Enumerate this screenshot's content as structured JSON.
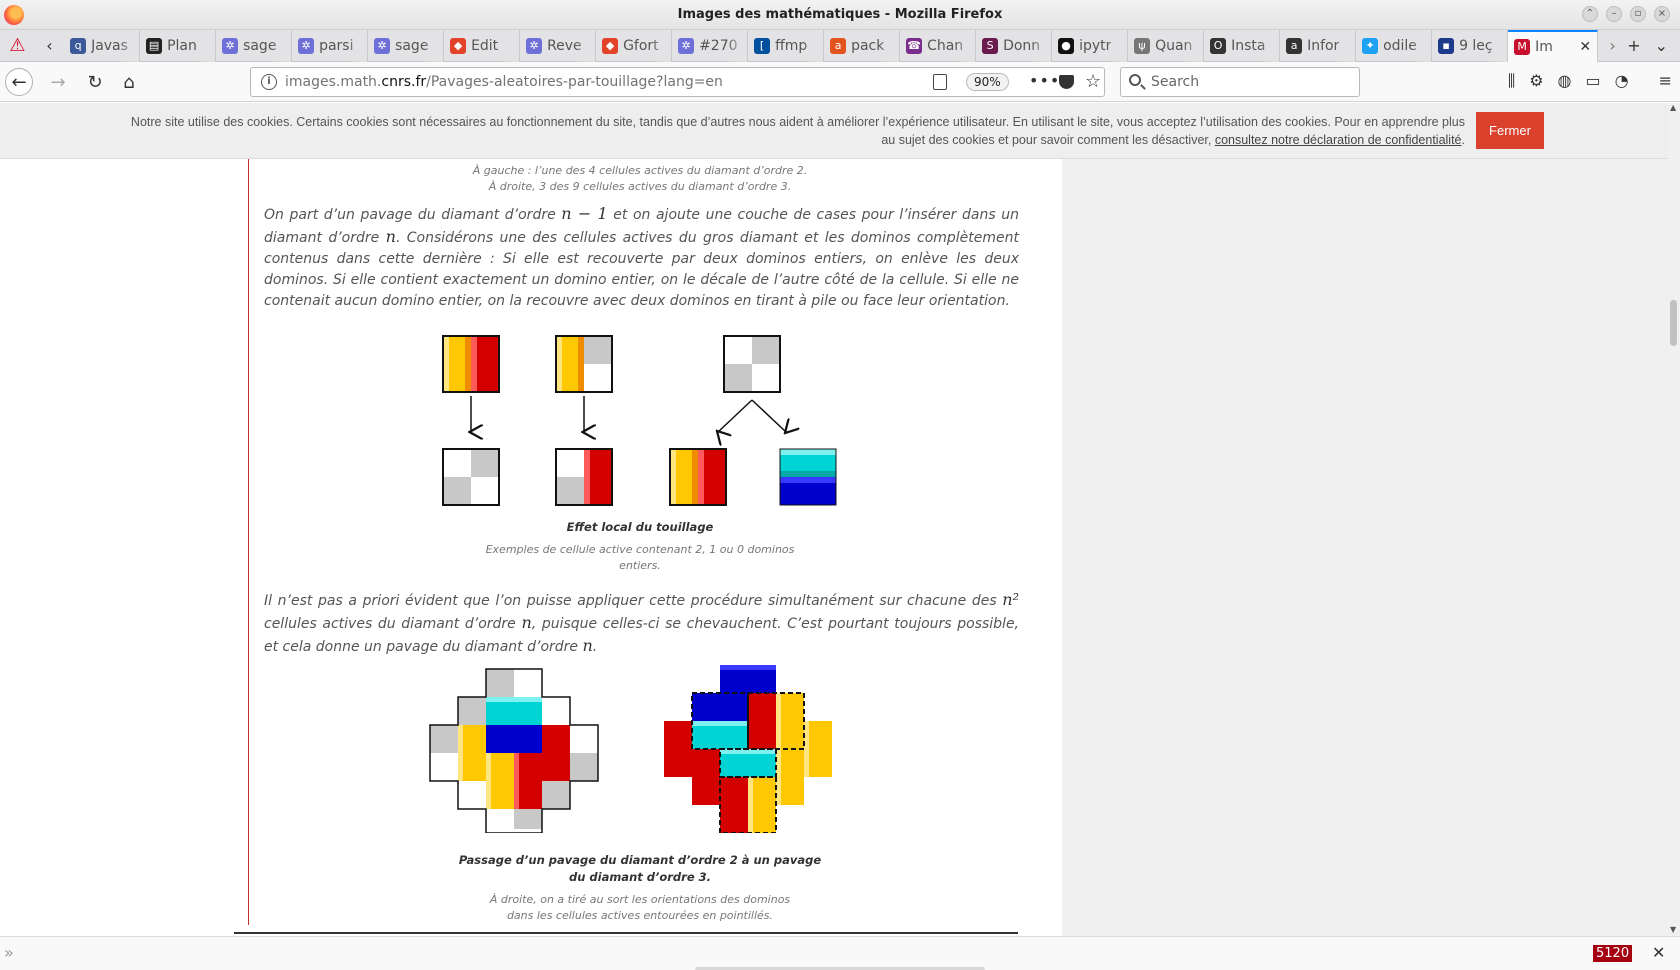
{
  "window": {
    "title": "Images des mathématiques - Mozilla Firefox"
  },
  "tabs": [
    {
      "label": "Javas",
      "icon": "q-icon",
      "color": "#3b5998"
    },
    {
      "label": "Plan",
      "icon": "document-icon",
      "color": "#222222"
    },
    {
      "label": "sage",
      "icon": "sage-icon",
      "color": "#6f6fd8"
    },
    {
      "label": "parsi",
      "icon": "sage-icon",
      "color": "#6f6fd8"
    },
    {
      "label": "sage",
      "icon": "sage-icon",
      "color": "#6f6fd8"
    },
    {
      "label": "Edit",
      "icon": "gitlab-icon",
      "color": "#e24329"
    },
    {
      "label": "Reve",
      "icon": "sage-icon",
      "color": "#6f6fd8"
    },
    {
      "label": "Gfort",
      "icon": "gitlab-icon",
      "color": "#e24329"
    },
    {
      "label": "#270",
      "icon": "sage-icon",
      "color": "#6f6fd8"
    },
    {
      "label": "ffmp",
      "icon": "bracket-icon",
      "color": "#0050a0"
    },
    {
      "label": "pack",
      "icon": "ask-icon",
      "color": "#e2531d"
    },
    {
      "label": "Chan",
      "icon": "phone-icon",
      "color": "#7b2d8e"
    },
    {
      "label": "Donn",
      "icon": "s-icon",
      "color": "#6a1b4d"
    },
    {
      "label": "ipytr",
      "icon": "github-icon",
      "color": "#111111"
    },
    {
      "label": "Quan",
      "icon": "fork-icon",
      "color": "#777777"
    },
    {
      "label": "Insta",
      "icon": "o-icon",
      "color": "#333333"
    },
    {
      "label": "Infor",
      "icon": "aa-icon",
      "color": "#333333"
    },
    {
      "label": "odile",
      "icon": "twitter-icon",
      "color": "#1da1f2"
    },
    {
      "label": "9 leç",
      "icon": "news-icon",
      "color": "#1e3a8a"
    },
    {
      "label": "Im",
      "icon": "idm-icon",
      "color": "#c8102e",
      "active": true
    }
  ],
  "navbar": {
    "url_prefix": "images.math.",
    "url_domain": "cnrs.fr",
    "url_path": "/Pavages-aleatoires-par-touillage?lang=en",
    "zoom": "90%",
    "search_placeholder": "Search"
  },
  "cookie": {
    "line1": "Notre site utilise des cookies. Certains cookies sont nécessaires au fonctionnement du site, tandis que d’autres nous aident à améliorer l’expérience utilisateur. En utilisant le site, vous acceptez l’utilisation des cookies. Pour en apprendre plus",
    "line2_prefix": "au sujet des cookies et pour savoir comment les désactiver, ",
    "line2_link": "consultez notre déclaration de confidentialité",
    "line2_suffix": ".",
    "button": "Fermer"
  },
  "article": {
    "top_caption_1": "À gauche : l’une des 4 cellules actives du diamant d’ordre 2.",
    "top_caption_2": "À droite, 3 des 9 cellules actives du diamant d’ordre 3.",
    "p1_a": "On part d’un pavage du diamant d’ordre ",
    "p1_math1": "n − 1",
    "p1_b": " et on ajoute une couche de cases pour l’insérer dans un diamant d’ordre ",
    "p1_math2": "n",
    "p1_c": ". Considérons une des cellules actives du gros diamant et les dominos complètement contenus dans cette dernière : Si elle est recouverte par deux dominos entiers, on enlève les deux dominos. Si elle contient exactement un domino entier, on le décale de l’autre côté de la cellule. Si elle ne contenait aucun domino entier, on la recouvre avec deux dominos en tirant à pile ou face leur orientation.",
    "fig1_title": "Effet local du touillage",
    "fig1_caption_1": "Exemples de cellule active contenant 2, 1 ou 0 dominos",
    "fig1_caption_2": "entiers.",
    "p2_a": "Il n’est pas a priori évident que l’on puisse appliquer cette procédure simultanément sur chacune des ",
    "p2_math1": "n²",
    "p2_b": " cellules actives du diamant d’ordre ",
    "p2_math2": "n",
    "p2_c": ", puisque celles-ci se chevauchent. C’est pourtant toujours possible, et cela donne un pavage du diamant d’ordre ",
    "p2_math3": "n",
    "p2_d": ".",
    "fig2_title_1": "Passage d’un pavage du diamant d’ordre 2 à un pavage",
    "fig2_title_2": "du diamant d’ordre 3.",
    "fig2_caption_1": "À droite, on a tiré au sort les orientations des dominos",
    "fig2_caption_2": "dans les cellules actives entourées en pointillés."
  },
  "findbar": {
    "count": "5120"
  },
  "colors": {
    "yellow": "#ffc800",
    "red": "#d40000",
    "cyan": "#00d3d3",
    "blue": "#0000cc",
    "gray": "#c8c8c8",
    "cookie_button": "#d9412d"
  }
}
